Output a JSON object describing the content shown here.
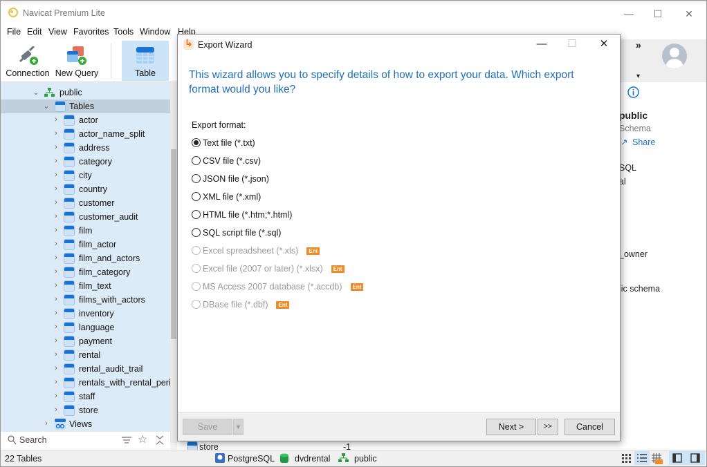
{
  "app": {
    "title": "Navicat Premium Lite",
    "window_controls": {
      "minimize": "—",
      "maximize": "☐",
      "close": "✕"
    }
  },
  "menu": [
    "File",
    "Edit",
    "View",
    "Favorites",
    "Tools",
    "Window",
    "Help"
  ],
  "toolbar": {
    "buttons": [
      {
        "label": "Connection",
        "icon": "plug-add-icon"
      },
      {
        "label": "New Query",
        "icon": "query-add-icon"
      },
      {
        "label": "Table",
        "icon": "table-icon",
        "active": true
      }
    ],
    "overflow": "»",
    "dropdown": "▾"
  },
  "sidebar": {
    "schema": "public",
    "tables_node": "Tables",
    "tables": [
      "actor",
      "actor_name_split",
      "address",
      "category",
      "city",
      "country",
      "customer",
      "customer_audit",
      "film",
      "film_actor",
      "film_and_actors",
      "film_category",
      "film_text",
      "films_with_actors",
      "inventory",
      "language",
      "payment",
      "rental",
      "rental_audit_trail",
      "rentals_with_rental_perio",
      "staff",
      "store"
    ],
    "views_node": "Views",
    "search_placeholder": "Search"
  },
  "status": {
    "count": "22 Tables",
    "connection_type": "PostgreSQL",
    "database": "dvdrental",
    "schema": "public"
  },
  "background_row": {
    "name": "store",
    "value": "-1"
  },
  "right_pane": {
    "title": "public",
    "subtitle": "Schema",
    "share": "Share",
    "line1": "SQL",
    "line2": "al",
    "line3": "_owner",
    "line4": "lic schema"
  },
  "dialog": {
    "title": "Export Wizard",
    "intro": "This wizard allows you to specify details of how to export your data. Which export format would you like?",
    "format_label": "Export format:",
    "options": [
      {
        "label": "Text file (*.txt)",
        "selected": true,
        "enabled": true
      },
      {
        "label": "CSV file (*.csv)",
        "selected": false,
        "enabled": true
      },
      {
        "label": "JSON file (*.json)",
        "selected": false,
        "enabled": true
      },
      {
        "label": "XML file (*.xml)",
        "selected": false,
        "enabled": true
      },
      {
        "label": "HTML file (*.htm;*.html)",
        "selected": false,
        "enabled": true
      },
      {
        "label": "SQL script file (*.sql)",
        "selected": false,
        "enabled": true
      },
      {
        "label": "Excel spreadsheet (*.xls)",
        "selected": false,
        "enabled": false,
        "badge": "Ent"
      },
      {
        "label": "Excel file (2007 or later) (*.xlsx)",
        "selected": false,
        "enabled": false,
        "badge": "Ent"
      },
      {
        "label": "MS Access 2007 database (*.accdb)",
        "selected": false,
        "enabled": false,
        "badge": "Ent"
      },
      {
        "label": "DBase file (*.dbf)",
        "selected": false,
        "enabled": false,
        "badge": "Ent"
      }
    ],
    "buttons": {
      "save": "Save",
      "next": "Next >",
      "finish": ">>",
      "cancel": "Cancel"
    }
  },
  "colors": {
    "accent": "#1f6fb8",
    "ent_badge": "#f08a24",
    "sidebar_bg": "#ddeaf8",
    "selected_row": "#c2cfdc"
  }
}
